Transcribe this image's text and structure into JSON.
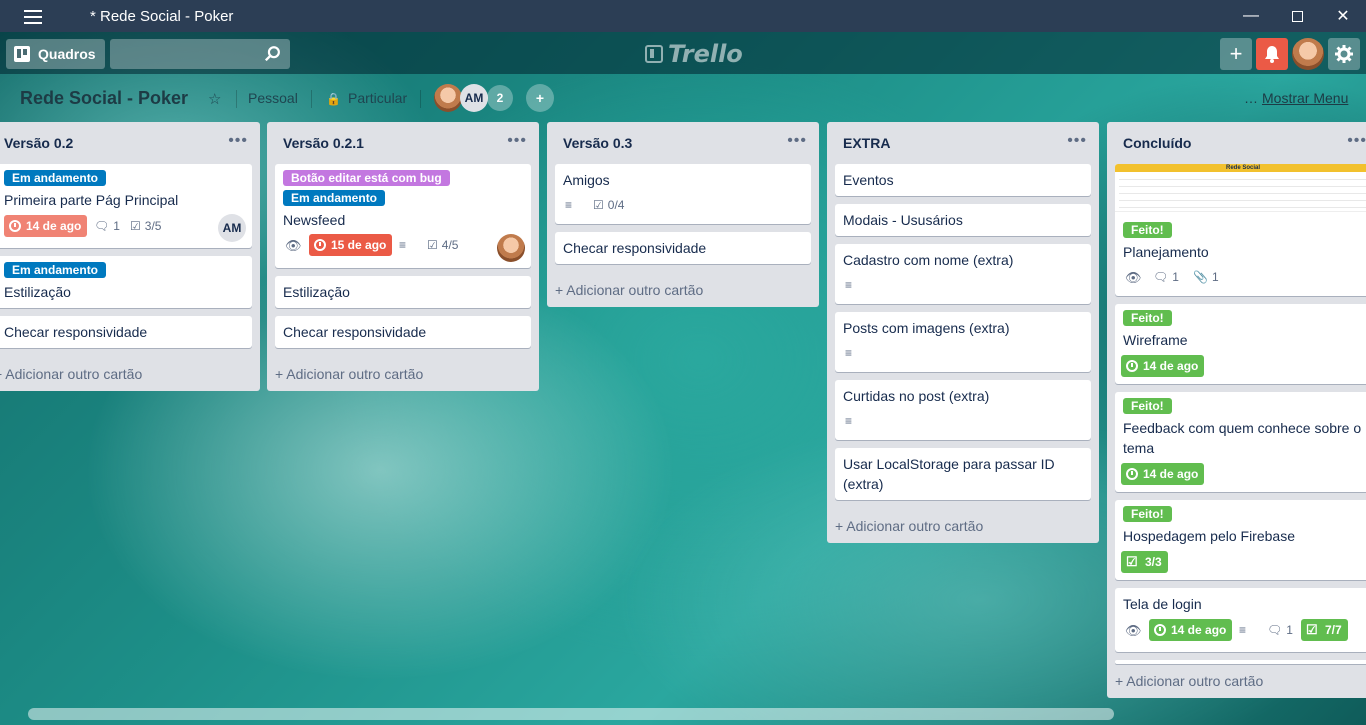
{
  "window": {
    "title": "* Rede Social - Poker"
  },
  "topbar": {
    "boards_label": "Quadros",
    "logo_text": "Trello"
  },
  "header": {
    "board_name": "Rede Social - Poker",
    "team": "Pessoal",
    "visibility": "Particular",
    "member_initials": "AM",
    "extra_members_count": "2",
    "menu_label": "Mostrar Menu"
  },
  "colors": {
    "label_blue": "#0079bf",
    "label_purple": "#c377e0",
    "label_green": "#61bd4f",
    "due_red": "#eb5a46",
    "due_green": "#61bd4f",
    "notif": "#eb5a46"
  },
  "lists": [
    {
      "title": "Versão 0.2",
      "add": "+ Adicionar outro cartão",
      "cards": [
        {
          "label": "Em andamento",
          "title": "Primeira parte Pág Principal",
          "due": "14 de ago",
          "comments": "1",
          "checklist": "3/5",
          "member": "AM"
        },
        {
          "label": "Em andamento",
          "title": "Estilização"
        },
        {
          "title": "Checar responsividade"
        }
      ]
    },
    {
      "title": "Versão 0.2.1",
      "add": "+ Adicionar outro cartão",
      "cards": [
        {
          "label1": "Botão editar está com bug",
          "label2": "Em andamento",
          "title": "Newsfeed",
          "due": "15 de ago",
          "checklist": "4/5"
        },
        {
          "title": "Estilização"
        },
        {
          "title": "Checar responsividade"
        }
      ]
    },
    {
      "title": "Versão 0.3",
      "add": "+ Adicionar outro cartão",
      "cards": [
        {
          "title": "Amigos",
          "checklist": "0/4"
        },
        {
          "title": "Checar responsividade"
        }
      ]
    },
    {
      "title": "EXTRA",
      "add": "+ Adicionar outro cartão",
      "cards": [
        {
          "title": "Eventos"
        },
        {
          "title": "Modais - Ususários"
        },
        {
          "title": "Cadastro com nome (extra)"
        },
        {
          "title": "Posts com imagens (extra)"
        },
        {
          "title": "Curtidas no post (extra)"
        },
        {
          "title": "Usar LocalStorage para passar ID (extra)"
        }
      ]
    },
    {
      "title": "Concluído",
      "add": "+ Adicionar outro cartão",
      "cards": [
        {
          "label": "Feito!",
          "title": "Planejamento",
          "comments": "1",
          "attachments": "1",
          "cover_title": "Rede Social"
        },
        {
          "label": "Feito!",
          "title": "Wireframe",
          "due": "14 de ago"
        },
        {
          "label": "Feito!",
          "title": "Feedback com quem conhece sobre o tema",
          "due": "14 de ago"
        },
        {
          "label": "Feito!",
          "title": "Hospedagem pelo Firebase",
          "checklist": "3/3"
        },
        {
          "title": "Tela de login",
          "due": "14 de ago",
          "comments": "1",
          "checklist": "7/7"
        }
      ]
    }
  ]
}
